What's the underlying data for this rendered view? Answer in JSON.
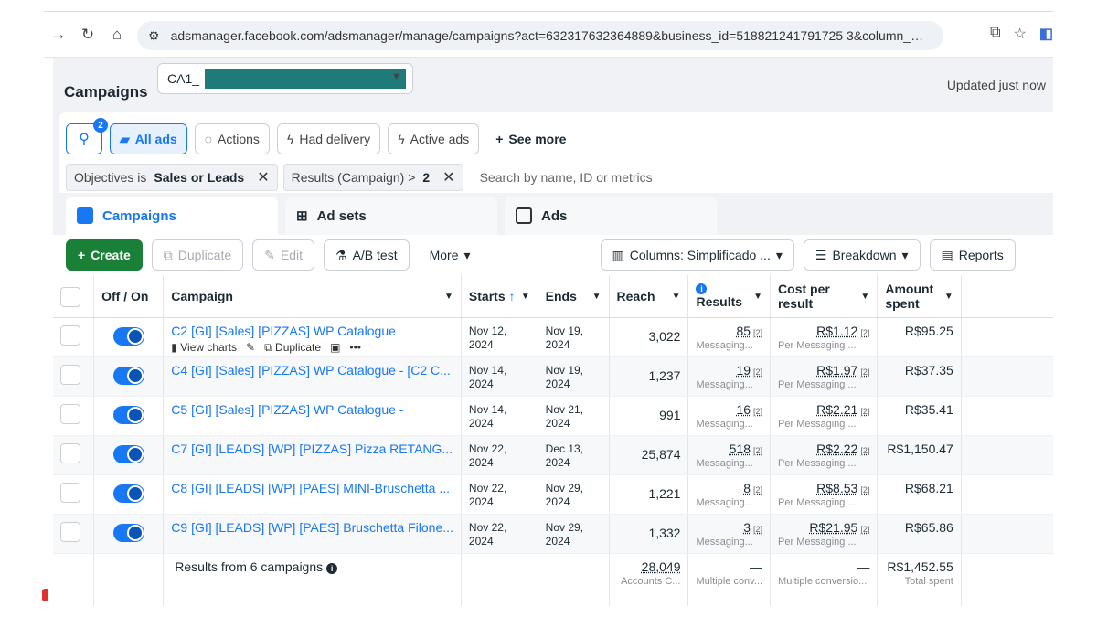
{
  "browser": {
    "url": "adsmanager.facebook.com/adsmanager/manage/campaigns?act=632317632364889&business_id=518821241791725 3&column_preset=1016..."
  },
  "header": {
    "title": "Campaigns",
    "account_prefix": "CA1_",
    "updated": "Updated just now"
  },
  "filters": {
    "search_badge": "2",
    "buttons": [
      "All ads",
      "Actions",
      "Had delivery",
      "Active ads",
      "See more"
    ],
    "chips": [
      {
        "label": "Objectives is",
        "value": "Sales or Leads"
      },
      {
        "label": "Results (Campaign) >",
        "value": "2"
      }
    ],
    "search_placeholder": "Search by name, ID or metrics"
  },
  "tabs": [
    "Campaigns",
    "Ad sets",
    "Ads"
  ],
  "toolbar": {
    "create": "Create",
    "duplicate": "Duplicate",
    "edit": "Edit",
    "ab_test": "A/B test",
    "more": "More",
    "columns": "Columns: Simplificado ...",
    "breakdown": "Breakdown",
    "reports": "Reports"
  },
  "table": {
    "headers": {
      "offon": "Off / On",
      "campaign": "Campaign",
      "starts": "Starts",
      "ends": "Ends",
      "reach": "Reach",
      "results": "Results",
      "cost": "Cost per result",
      "amount": "Amount spent"
    },
    "row_actions": {
      "view_charts": "View charts",
      "duplicate": "Duplicate",
      "more": "•••"
    },
    "rows": [
      {
        "name": "C2 [GI] [Sales] [PIZZAS] WP Catalogue",
        "starts": "Nov 12, 2024",
        "ends": "Nov 19, 2024",
        "reach": "3,022",
        "results": "85",
        "results_sub": "Messaging...",
        "cost": "R$1.12",
        "cost_sub": "Per Messaging ...",
        "amount": "R$95.25"
      },
      {
        "name": "C4 [GI] [Sales] [PIZZAS] WP Catalogue - [C2 C...",
        "starts": "Nov 14, 2024",
        "ends": "Nov 19, 2024",
        "reach": "1,237",
        "results": "19",
        "results_sub": "Messaging...",
        "cost": "R$1.97",
        "cost_sub": "Per Messaging ...",
        "amount": "R$37.35"
      },
      {
        "name": "C5 [GI] [Sales] [PIZZAS] WP Catalogue -",
        "starts": "Nov 14, 2024",
        "ends": "Nov 21, 2024",
        "reach": "991",
        "results": "16",
        "results_sub": "Messaging...",
        "cost": "R$2.21",
        "cost_sub": "Per Messaging ...",
        "amount": "R$35.41"
      },
      {
        "name": "C7 [GI] [LEADS] [WP] [PIZZAS] Pizza RETANG...",
        "starts": "Nov 22, 2024",
        "ends": "Dec 13, 2024",
        "reach": "25,874",
        "results": "518",
        "results_sub": "Messaging...",
        "cost": "R$2.22",
        "cost_sub": "Per Messaging ...",
        "amount": "R$1,150.47"
      },
      {
        "name": "C8 [GI] [LEADS] [WP] [PAES] MINI-Bruschetta ...",
        "starts": "Nov 22, 2024",
        "ends": "Nov 29, 2024",
        "reach": "1,221",
        "results": "8",
        "results_sub": "Messaging...",
        "cost": "R$8.53",
        "cost_sub": "Per Messaging ...",
        "amount": "R$68.21"
      },
      {
        "name": "C9 [GI] [LEADS] [WP] [PAES] Bruschetta Filone...",
        "starts": "Nov 22, 2024",
        "ends": "Nov 29, 2024",
        "reach": "1,332",
        "results": "3",
        "results_sub": "Messaging...",
        "cost": "R$21.95",
        "cost_sub": "Per Messaging ...",
        "amount": "R$65.86"
      }
    ],
    "sup_marker": "[2]",
    "totals": {
      "label": "Results from 6 campaigns",
      "reach": "28,049",
      "reach_sub": "Accounts C...",
      "results": "—",
      "results_sub": "Multiple conv...",
      "cost": "—",
      "cost_sub": "Multiple conversio...",
      "amount": "R$1,452.55",
      "amount_sub": "Total spent"
    }
  },
  "colors": {
    "accent": "#1877f2",
    "create_green": "#1a7f37",
    "redaction": "#1f7a7a"
  }
}
